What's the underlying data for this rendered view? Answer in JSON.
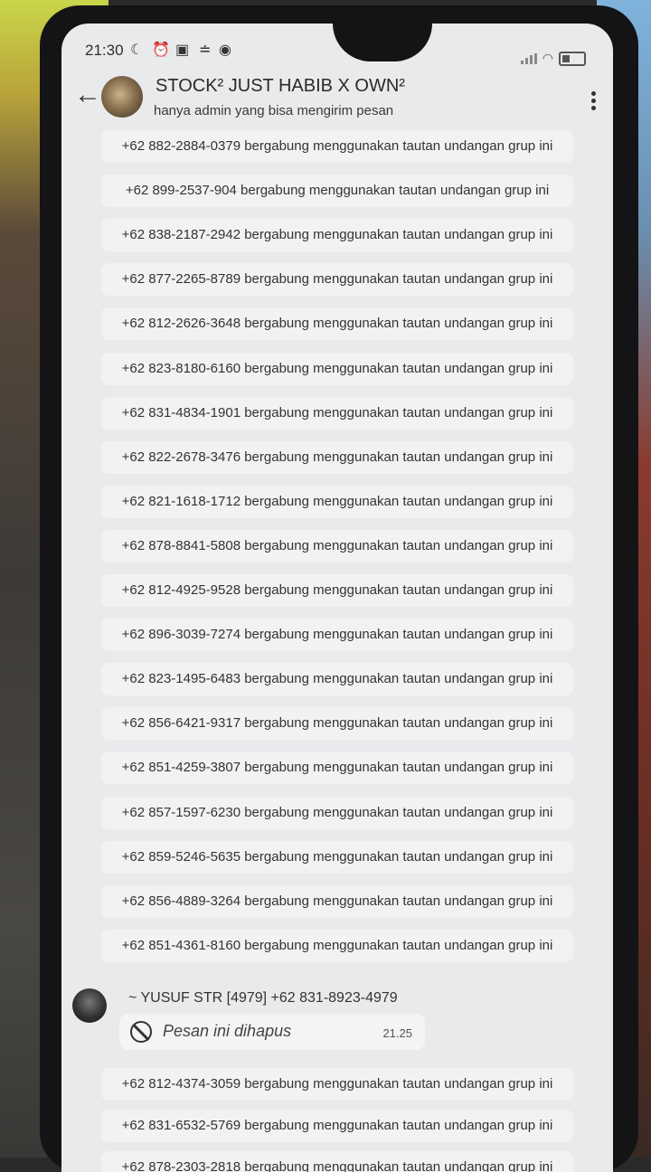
{
  "status_bar": {
    "time": "21:30",
    "icons": [
      "moon-icon",
      "alarm-icon",
      "nfc-icon",
      "data-icon",
      "app-icon"
    ],
    "battery_icon": "battery-icon",
    "wifi_icon": "wifi-icon"
  },
  "header": {
    "title": "STOCK² JUST HABIB X OWN²",
    "subtitle": "hanya admin yang bisa mengirim pesan",
    "back_icon": "arrow-left-icon",
    "menu_icon": "more-vert-icon"
  },
  "messages_before": [
    "+62 882-2884-0379 bergabung menggunakan tautan undangan grup ini",
    "+62 899-2537-904 bergabung menggunakan tautan undangan grup ini",
    "+62 838-2187-2942 bergabung menggunakan tautan undangan grup ini",
    "+62 877-2265-8789 bergabung menggunakan tautan undangan grup ini",
    "+62 812-2626-3648 bergabung menggunakan tautan undangan grup ini",
    "+62 823-8180-6160 bergabung menggunakan tautan undangan grup ini",
    "+62 831-4834-1901 bergabung menggunakan tautan undangan grup ini",
    "+62 822-2678-3476 bergabung menggunakan tautan undangan grup ini",
    "+62 821-1618-1712 bergabung menggunakan tautan undangan grup ini",
    "+62 878-8841-5808 bergabung menggunakan tautan undangan grup ini",
    "+62 812-4925-9528 bergabung menggunakan tautan undangan grup ini",
    "+62 896-3039-7274 bergabung menggunakan tautan undangan grup ini",
    "+62 823-1495-6483 bergabung menggunakan tautan undangan grup ini",
    "+62 856-6421-9317 bergabung menggunakan tautan undangan grup ini",
    "+62 851-4259-3807 bergabung menggunakan tautan undangan grup ini",
    "+62 857-1597-6230 bergabung menggunakan tautan undangan grup ini",
    "+62 859-5246-5635 bergabung menggunakan tautan undangan grup ini",
    "+62 856-4889-3264 bergabung menggunakan tautan undangan grup ini",
    "+62 851-4361-8160 bergabung menggunakan tautan undangan grup ini"
  ],
  "deleted_message": {
    "sender": "~ YUSUF STR [4979]   +62 831-8923-4979",
    "text": "Pesan ini dihapus",
    "time": "21.25"
  },
  "messages_after": [
    "+62 812-4374-3059 bergabung menggunakan tautan undangan grup ini",
    "+62 831-6532-5769 bergabung menggunakan tautan undangan grup ini",
    "+62 878-2303-2818 bergabung menggunakan tautan undangan grup ini"
  ]
}
